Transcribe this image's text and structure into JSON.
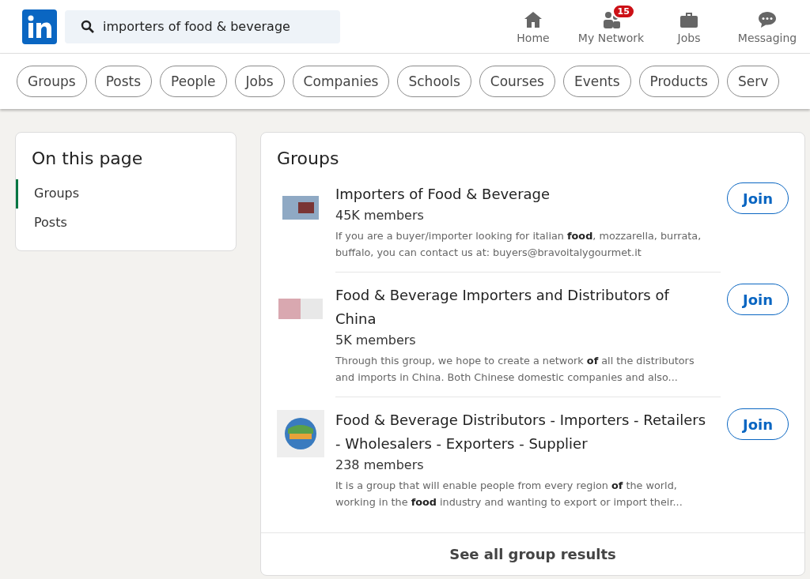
{
  "search": {
    "value": "importers of food & beverage"
  },
  "nav": [
    {
      "kind": "home",
      "label": "Home"
    },
    {
      "kind": "network",
      "label": "My Network",
      "badge": "15"
    },
    {
      "kind": "jobs",
      "label": "Jobs"
    },
    {
      "kind": "messaging",
      "label": "Messaging"
    }
  ],
  "filters": [
    "Groups",
    "Posts",
    "People",
    "Jobs",
    "Companies",
    "Schools",
    "Courses",
    "Events",
    "Products",
    "Serv"
  ],
  "sidebar": {
    "title": "On this page",
    "items": [
      {
        "label": "Groups",
        "selected": true
      },
      {
        "label": "Posts",
        "selected": false
      }
    ]
  },
  "results": {
    "title": "Groups",
    "groups": [
      {
        "name": "Importers of Food & Beverage",
        "members": "45K members",
        "description": "If you are a buyer/importer looking for italian **food**, mozzarella, burrata, buffalo, you can contact us at: buyers@bravoitalygourmet.it",
        "action": "Join",
        "kind": "photo"
      },
      {
        "name": "Food & Beverage Importers and Distributors of China",
        "members": "5K members",
        "description": "Through this group, we hope to create a network **of** all the distributors and imports in China. Both Chinese domestic companies and also...",
        "action": "Join",
        "kind": "pattern"
      },
      {
        "name": "Food & Beverage Distributors - Importers - Retailers - Wholesalers - Exporters - Supplier",
        "members": "238 members",
        "description": "It is a group that will enable people from every region **of** the world, working in the **food** industry and wanting to export or import their...",
        "action": "Join",
        "kind": "globe"
      }
    ],
    "footer": "See all group results"
  }
}
